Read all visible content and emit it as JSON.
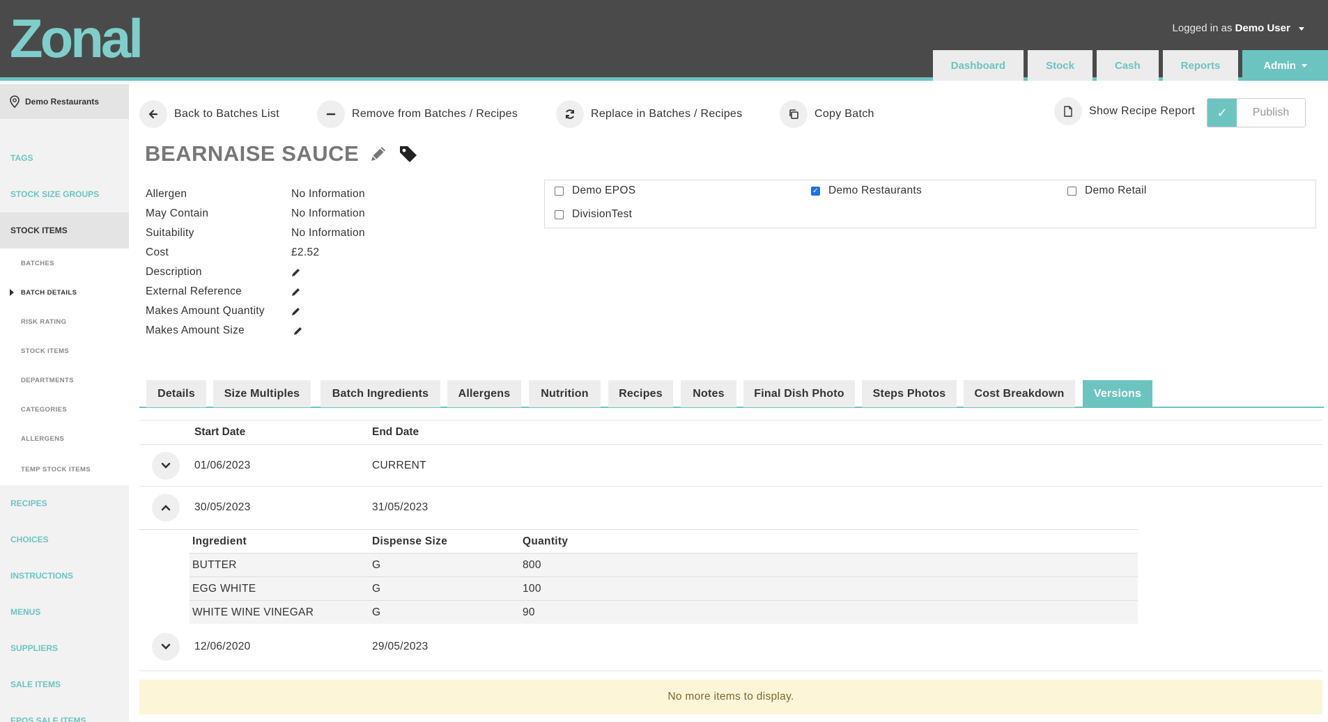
{
  "brand": {
    "logo_text": "Zonal",
    "accent": "#6cc4c0",
    "header_bg": "#4a4a4a"
  },
  "header": {
    "logged_in_prefix": "Logged in as",
    "user": "Demo User",
    "nav": [
      {
        "label": "Dashboard"
      },
      {
        "label": "Stock"
      },
      {
        "label": "Cash"
      },
      {
        "label": "Reports"
      },
      {
        "label": "Admin",
        "active": true
      }
    ]
  },
  "sidebar": {
    "site": "Demo Restaurants",
    "items": [
      {
        "label": "TAGS"
      },
      {
        "label": "STOCK SIZE GROUPS"
      },
      {
        "label": "STOCK ITEMS",
        "active": true
      },
      {
        "label": "RECIPES"
      },
      {
        "label": "CHOICES"
      },
      {
        "label": "INSTRUCTIONS"
      },
      {
        "label": "MENUS"
      },
      {
        "label": "SUPPLIERS"
      },
      {
        "label": "SALE ITEMS"
      },
      {
        "label": "EPOS SALE ITEMS"
      }
    ],
    "subitems": [
      {
        "label": "BATCHES"
      },
      {
        "label": "BATCH DETAILS",
        "current": true
      },
      {
        "label": "RISK RATING"
      },
      {
        "label": "STOCK ITEMS"
      },
      {
        "label": "DEPARTMENTS"
      },
      {
        "label": "CATEGORIES"
      },
      {
        "label": "ALLERGENS"
      },
      {
        "label": "TEMP STOCK ITEMS"
      }
    ]
  },
  "actions": {
    "back": "Back to Batches List",
    "remove": "Remove from Batches / Recipes",
    "replace": "Replace in Batches / Recipes",
    "copy": "Copy Batch",
    "report": "Show Recipe Report",
    "publish": "Publish"
  },
  "batch": {
    "title": "BEARNAISE SAUCE",
    "props": [
      {
        "key": "Allergen",
        "value": "No Information"
      },
      {
        "key": "May Contain",
        "value": "No Information"
      },
      {
        "key": "Suitability",
        "value": "No Information"
      },
      {
        "key": "Cost",
        "value": "£2.52"
      },
      {
        "key": "Description",
        "value": ""
      },
      {
        "key": "External Reference",
        "value": ""
      },
      {
        "key": "Makes Amount Quantity",
        "value": ""
      },
      {
        "key": "Makes Amount Size",
        "value": ""
      }
    ]
  },
  "divisions": [
    {
      "label": "Demo EPOS",
      "checked": false
    },
    {
      "label": "Demo Restaurants",
      "checked": true
    },
    {
      "label": "Demo Retail",
      "checked": false
    },
    {
      "label": "DivisionTest",
      "checked": false
    }
  ],
  "tabs": [
    {
      "label": "Details"
    },
    {
      "label": "Size Multiples"
    },
    {
      "label": "Batch Ingredients"
    },
    {
      "label": "Allergens"
    },
    {
      "label": "Nutrition"
    },
    {
      "label": "Recipes"
    },
    {
      "label": "Notes"
    },
    {
      "label": "Final Dish Photo"
    },
    {
      "label": "Steps Photos"
    },
    {
      "label": "Cost Breakdown"
    },
    {
      "label": "Versions",
      "active": true
    }
  ],
  "versions": {
    "columns": {
      "start": "Start Date",
      "end": "End Date"
    },
    "rows": [
      {
        "start": "01/06/2023",
        "end": "CURRENT",
        "expanded": false
      },
      {
        "start": "30/05/2023",
        "end": "31/05/2023",
        "expanded": true
      },
      {
        "start": "12/06/2020",
        "end": "29/05/2023",
        "expanded": false
      }
    ],
    "ingredient_columns": {
      "ingredient": "Ingredient",
      "size": "Dispense Size",
      "qty": "Quantity"
    },
    "ingredients": [
      {
        "ingredient": "BUTTER",
        "size": "G",
        "qty": "800"
      },
      {
        "ingredient": "EGG WHITE",
        "size": "G",
        "qty": "100"
      },
      {
        "ingredient": "WHITE WINE VINEGAR",
        "size": "G",
        "qty": "90"
      }
    ],
    "footer": "No more items to display."
  }
}
